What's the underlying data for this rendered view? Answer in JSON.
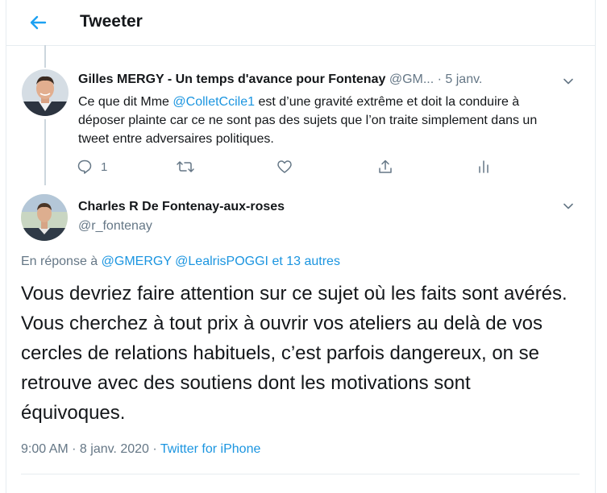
{
  "header": {
    "title": "Tweeter",
    "back_icon": "arrow-left-icon",
    "accent": "#1da1f2"
  },
  "tweet1": {
    "author_name": "Gilles MERGY - Un temps d'avance pour Fontenay",
    "handle": "@GM...",
    "separator": " · ",
    "date": "5 janv.",
    "text_before": "Ce que dit Mme ",
    "mention": "@ColletCcile1",
    "text_after": " est d’une gravité extrême et doit la conduire à déposer plainte car ce ne sont pas des sujets que l’on traite simplement dans un tweet entre adversaires politiques.",
    "reply_count": "1",
    "icons": [
      "reply-icon",
      "retweet-icon",
      "like-icon",
      "share-icon",
      "analytics-icon"
    ]
  },
  "tweet2": {
    "author_name": "Charles R De Fontenay-aux-roses",
    "handle": "@r_fontenay",
    "reply_prefix": "En réponse à ",
    "reply_mention1": "@GMERGY",
    "reply_mention2": "@LealrisPOGGI",
    "reply_others": "et 13 autres",
    "text": "Vous devriez faire attention sur ce sujet où les faits sont avérés. Vous cherchez à tout prix à ouvrir vos ateliers au delà de vos cercles de relations habituels, c’est parfois dangereux, on se retrouve avec des soutiens dont les motivations sont équivoques.",
    "time": "9:00 AM",
    "sep": " · ",
    "date": "8 janv. 2020",
    "sep2": " · ",
    "source": "Twitter for iPhone"
  },
  "colors": {
    "link": "#1b95e0",
    "muted": "#657786",
    "text": "#14171a",
    "border": "#e6ecf0"
  }
}
